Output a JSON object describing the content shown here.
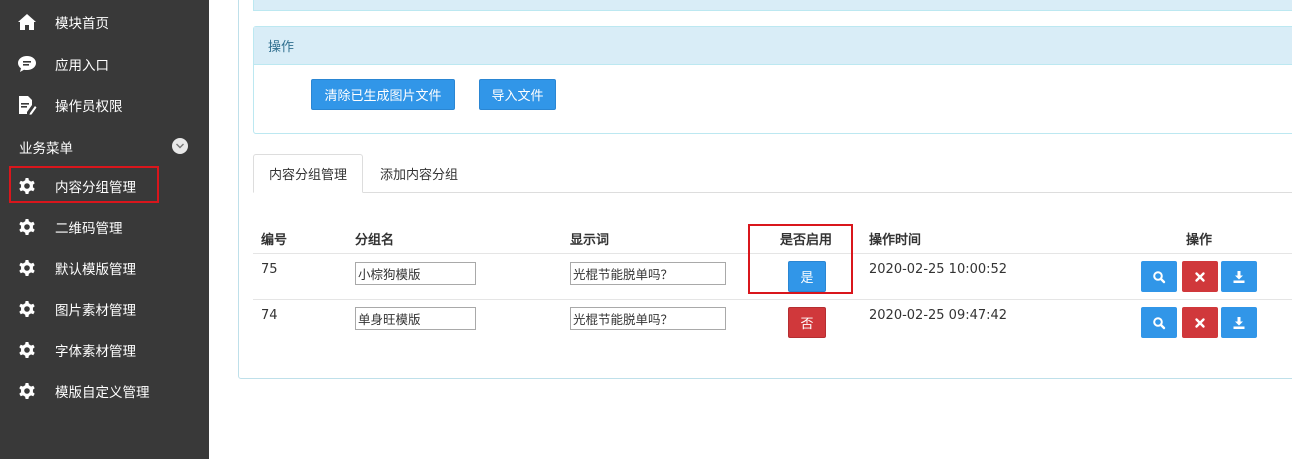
{
  "sidebar": {
    "items": [
      {
        "label": "模块首页",
        "icon": "home-icon"
      },
      {
        "label": "应用入口",
        "icon": "comment-icon"
      },
      {
        "label": "操作员权限",
        "icon": "edit-document-icon"
      }
    ],
    "group_label": "业务菜单",
    "group_items": [
      {
        "label": "内容分组管理",
        "icon": "gear-icon"
      },
      {
        "label": "二维码管理",
        "icon": "gear-icon"
      },
      {
        "label": "默认模版管理",
        "icon": "gear-icon"
      },
      {
        "label": "图片素材管理",
        "icon": "gear-icon"
      },
      {
        "label": "字体素材管理",
        "icon": "gear-icon"
      },
      {
        "label": "模版自定义管理",
        "icon": "gear-icon"
      }
    ]
  },
  "operations": {
    "title": "操作",
    "clear_button": "清除已生成图片文件",
    "import_button": "导入文件"
  },
  "tabs": [
    {
      "label": "内容分组管理",
      "active": true
    },
    {
      "label": "添加内容分组",
      "active": false
    }
  ],
  "table": {
    "headers": [
      "编号",
      "分组名",
      "显示词",
      "是否启用",
      "操作时间",
      "操作"
    ],
    "rows": [
      {
        "id": "75",
        "group_name": "小棕狗模版",
        "display_word": "光棍节能脱单吗？",
        "enabled": "是",
        "time": "2020-02-25 10:00:52"
      },
      {
        "id": "74",
        "group_name": "单身旺模版",
        "display_word": "光棍节能脱单吗？",
        "enabled": "否",
        "time": "2020-02-25 09:47:42"
      }
    ]
  },
  "colors": {
    "sidebar_bg": "#393939",
    "primary": "#3196e8",
    "danger": "#d0383b",
    "highlight": "#d9161c",
    "panel_head": "#d9edf7"
  }
}
